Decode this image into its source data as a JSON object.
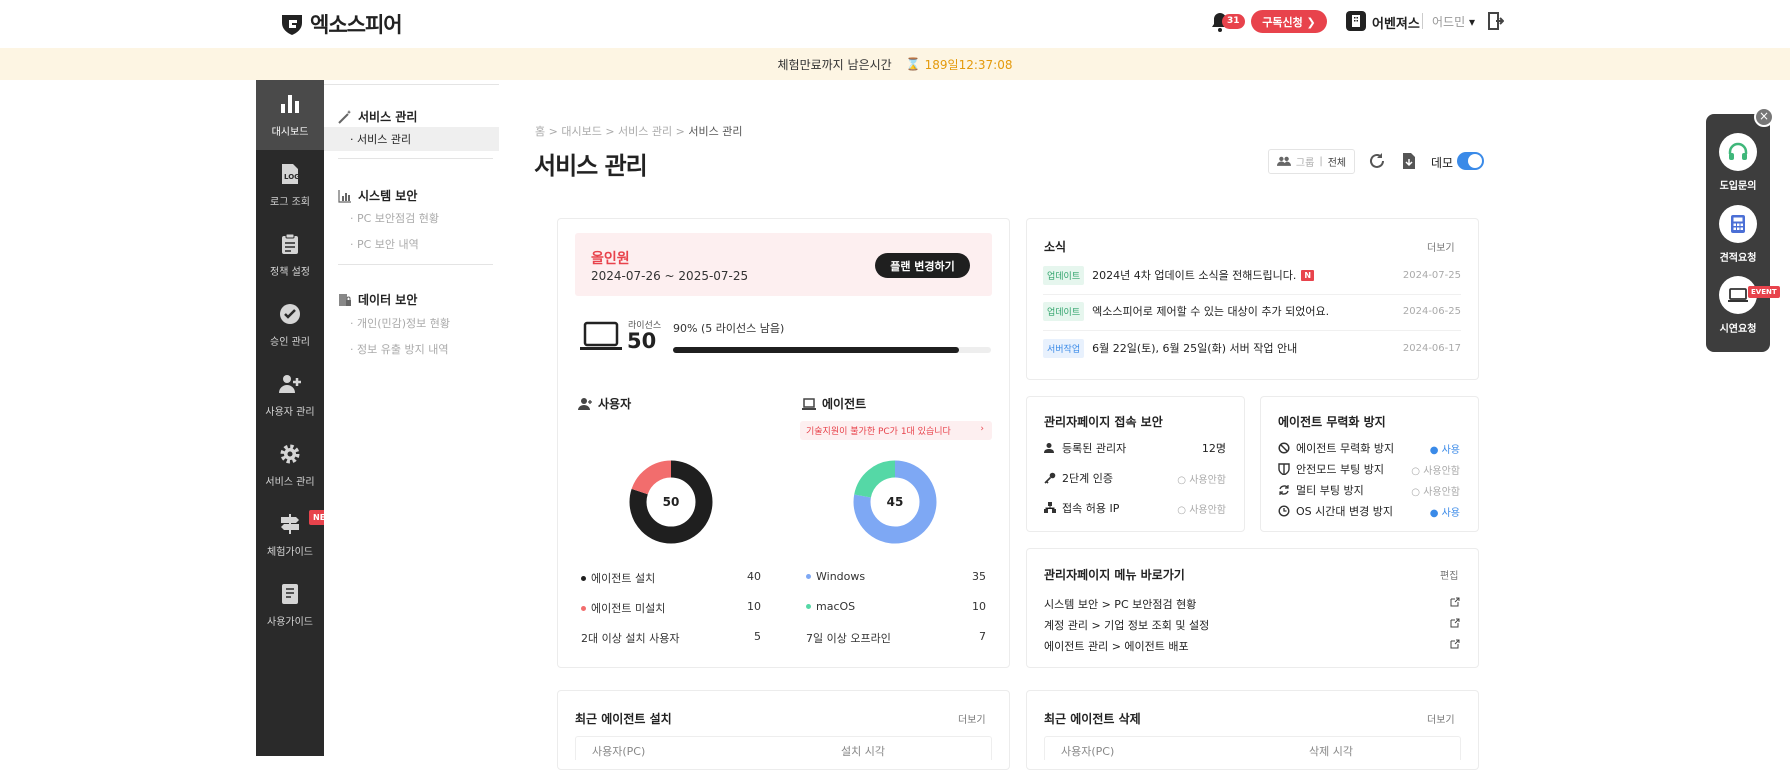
{
  "app": {
    "logo_text": "엑소스피어",
    "bell_count": "31",
    "subscribe": "구독신청 ❯",
    "org_name": "어벤져스",
    "role": "어드민"
  },
  "trial": {
    "label": "체험만료까지 남은시간",
    "remaining": "189일12:37:08",
    "hourglass": "⌛"
  },
  "sidebar": {
    "items": [
      {
        "label": "대시보드",
        "icon": "bar-chart-icon"
      },
      {
        "label": "로그 조회",
        "icon": "log-icon"
      },
      {
        "label": "정책 설정",
        "icon": "clipboard-icon"
      },
      {
        "label": "승인 관리",
        "icon": "check-circle-icon"
      },
      {
        "label": "사용자 관리",
        "icon": "user-plus-icon"
      },
      {
        "label": "서비스 관리",
        "icon": "gear-icon"
      },
      {
        "label": "체험가이드",
        "icon": "signpost-icon",
        "badge": "NEW"
      },
      {
        "label": "사용가이드",
        "icon": "book-icon"
      }
    ]
  },
  "submenu": {
    "service": {
      "title": "서비스 관리",
      "items": [
        "· 서비스 관리"
      ]
    },
    "system": {
      "title": "시스템 보안",
      "items": [
        "· PC 보안점검 현황",
        "· PC 보안 내역"
      ]
    },
    "data": {
      "title": "데이터 보안",
      "items": [
        "· 개인(민감)정보 현황",
        "· 정보 유출 방지 내역"
      ]
    }
  },
  "breadcrumb": {
    "home": "홈",
    "c1": "대시보드",
    "c2": "서비스 관리",
    "current": "서비스 관리",
    "sep": ">"
  },
  "page": {
    "title": "서비스 관리",
    "filter_group": "그룹",
    "filter_sep": "|",
    "filter_all": "전체",
    "demo_label": "데모",
    "demo_on": true
  },
  "plan": {
    "name": "올인원",
    "period": "2024-07-26 ~ 2025-07-25",
    "change_button": "플랜 변경하기"
  },
  "license": {
    "label": "라이선스",
    "count": "50",
    "usage_text": "90% (5 라이선스 남음)",
    "usage_fraction": 0.9
  },
  "users": {
    "title": "사용자",
    "total": "50",
    "segments": [
      {
        "name": "에이전트 설치",
        "value": 40,
        "color": "#1f1f1f"
      },
      {
        "name": "에이전트 미설치",
        "value": 10,
        "color": "#f26d6d"
      }
    ],
    "rows": [
      {
        "label": "에이전트 설치",
        "value": "40",
        "color": "#1f1f1f"
      },
      {
        "label": "에이전트 미설치",
        "value": "10",
        "color": "#f26d6d"
      },
      {
        "label": "2대 이상 설치 사용자",
        "value": "5",
        "color": ""
      }
    ]
  },
  "agents": {
    "title": "에이전트",
    "warning": "기술지원이 불가한 PC가 1대 있습니다",
    "total": "45",
    "segments": [
      {
        "name": "Windows",
        "value": 35,
        "color": "#7ea8f4"
      },
      {
        "name": "macOS",
        "value": 10,
        "color": "#55d8a6"
      }
    ],
    "rows": [
      {
        "label": "Windows",
        "value": "35",
        "color": "#7ea8f4"
      },
      {
        "label": "macOS",
        "value": "10",
        "color": "#55d8a6"
      },
      {
        "label": "7일 이상 오프라인",
        "value": "7",
        "color": ""
      }
    ]
  },
  "news": {
    "title": "소식",
    "more": "더보기",
    "items": [
      {
        "tag": "업데이트",
        "tag_color": "#2fa36b",
        "tag_bg": "#e6f6ee",
        "text": "2024년 4차 업데이트 소식을 전해드립니다.",
        "new_badge": "N",
        "date": "2024-07-25"
      },
      {
        "tag": "업데이트",
        "tag_color": "#2fa36b",
        "tag_bg": "#e6f6ee",
        "text": "엑소스피어로 제어할 수 있는 대상이 추가 되었어요.",
        "new_badge": "",
        "date": "2024-06-25"
      },
      {
        "tag": "서버작업",
        "tag_color": "#3a8ae8",
        "tag_bg": "#e8f1fd",
        "text": "6월 22일(토), 6월 25일(화) 서버 작업 안내",
        "new_badge": "",
        "date": "2024-06-17"
      }
    ]
  },
  "admin_security": {
    "title": "관리자페이지 접속 보안",
    "rows": [
      {
        "label": "등록된 관리자",
        "value": "12명",
        "icon": "user-icon"
      },
      {
        "label": "2단계 인증",
        "value": "사용안함",
        "icon": "key-icon"
      },
      {
        "label": "접속 허용 IP",
        "value": "사용안함",
        "icon": "network-icon"
      }
    ]
  },
  "tamper": {
    "title": "에이전트 무력화 방지",
    "rows": [
      {
        "label": "에이전트 무력화 방지",
        "value": "사용",
        "on": true
      },
      {
        "label": "안전모드 부팅 방지",
        "value": "사용안함",
        "on": false
      },
      {
        "label": "멀티 부팅 방지",
        "value": "사용안함",
        "on": false
      },
      {
        "label": "OS 시간대 변경 방지",
        "value": "사용",
        "on": true
      }
    ]
  },
  "shortcuts": {
    "title": "관리자페이지 메뉴 바로가기",
    "edit": "편집",
    "items": [
      "시스템 보안 > PC 보안점검 현황",
      "계정 관리 > 기업 정보 조회 및 설정",
      "에이전트 관리 > 에이전트 배포"
    ]
  },
  "recent_install": {
    "title": "최근 에이전트 설치",
    "more": "더보기",
    "col1": "사용자(PC)",
    "col2": "설치 시각"
  },
  "recent_delete": {
    "title": "최근 에이전트 삭제",
    "more": "더보기",
    "col1": "사용자(PC)",
    "col2": "삭제 시각"
  },
  "fab": {
    "close": "×",
    "items": [
      {
        "label": "도입문의",
        "icon": "headset-icon"
      },
      {
        "label": "견적요청",
        "icon": "calculator-icon"
      },
      {
        "label": "시연요청",
        "icon": "laptop-icon",
        "badge": "EVENT"
      }
    ]
  }
}
